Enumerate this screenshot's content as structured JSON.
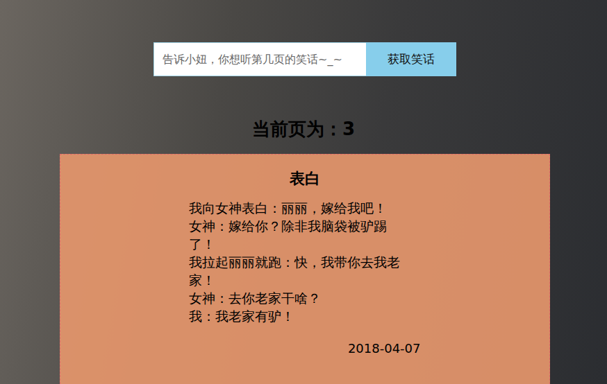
{
  "search": {
    "placeholder": "告诉小妞，你想听第几页的笑话~_~",
    "button": "获取笑话"
  },
  "page": {
    "label": "当前页为：",
    "number": "3"
  },
  "jokes": [
    {
      "title": "表白",
      "lines": [
        "我向女神表白：丽丽，嫁给我吧！",
        "女神：嫁给你？除非我脑袋被驴踢了！",
        "我拉起丽丽就跑：快，我带你去我老家！",
        "女神：去你老家干啥？",
        "我：我老家有驴！"
      ],
      "date": "2018-04-07"
    }
  ]
}
